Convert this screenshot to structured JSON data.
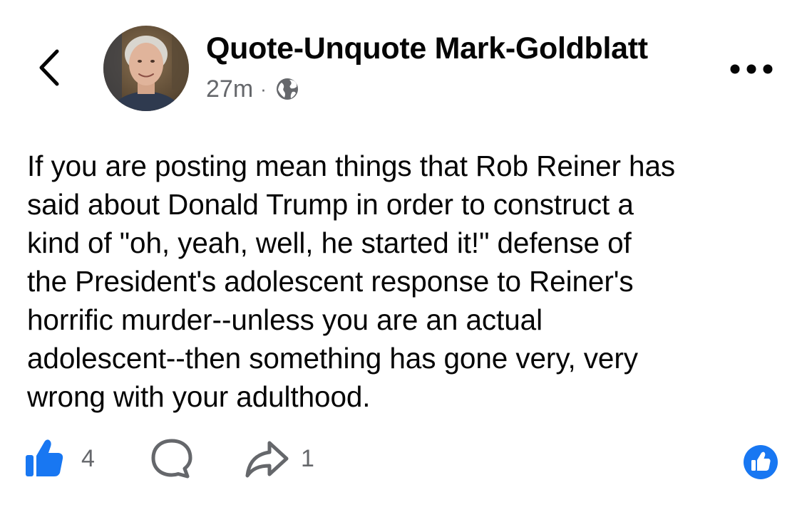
{
  "header": {
    "back_icon": "chevron-left-icon",
    "author_name": "Quote-Unquote Mark-Goldblatt",
    "timestamp": "27m",
    "separator": "·",
    "privacy_icon": "globe-icon",
    "more_icon": "ellipsis-icon"
  },
  "post": {
    "text": "If you are posting mean things that Rob Reiner has\nsaid about Donald Trump in order to construct a\nkind of \"oh, yeah, well, he started it!\" defense of\nthe President's adolescent response to Reiner's\nhorrific murder--unless you are an actual\nadolescent--then something has gone very, very\nwrong with your adulthood."
  },
  "actions": {
    "like_count": "4",
    "share_count": "1",
    "like_icon": "thumbs-up-icon",
    "comment_icon": "comment-bubble-icon",
    "share_icon": "share-arrow-icon",
    "reaction_icon": "like-reaction-icon"
  },
  "colors": {
    "accent": "#1877f2",
    "text": "#050505",
    "secondary_text": "#65676b"
  }
}
